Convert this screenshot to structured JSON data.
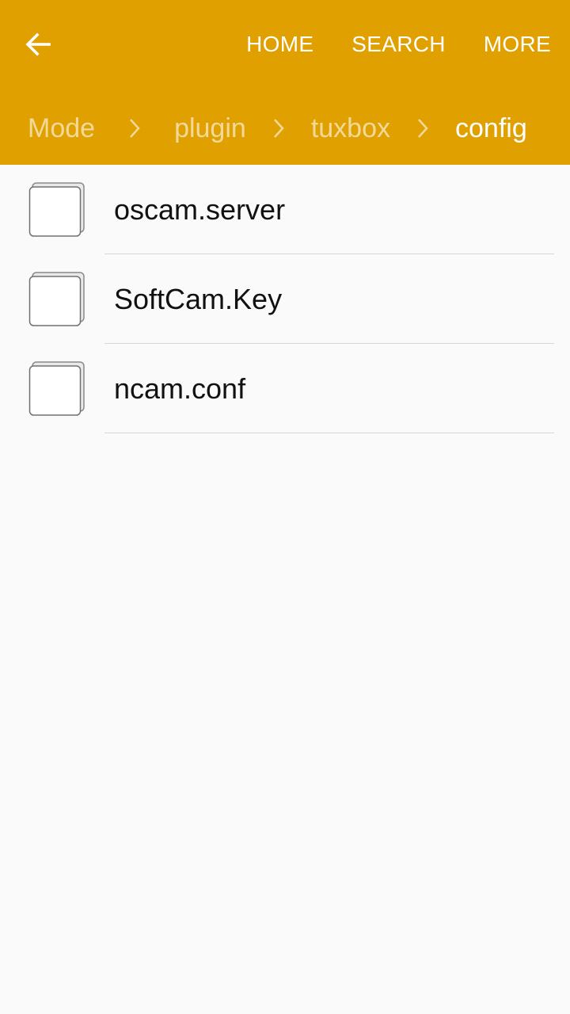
{
  "colors": {
    "header": "#e0a000",
    "background": "#fafafa",
    "text": "#111111"
  },
  "header": {
    "back_icon": "arrow-left-icon",
    "actions": [
      "HOME",
      "SEARCH",
      "MORE"
    ],
    "breadcrumb": [
      "Mode",
      "plugin",
      "tuxbox",
      "config"
    ]
  },
  "files": [
    {
      "name": "oscam.server",
      "icon": "file-icon"
    },
    {
      "name": "SoftCam.Key",
      "icon": "file-icon"
    },
    {
      "name": "ncam.conf",
      "icon": "file-icon"
    }
  ]
}
